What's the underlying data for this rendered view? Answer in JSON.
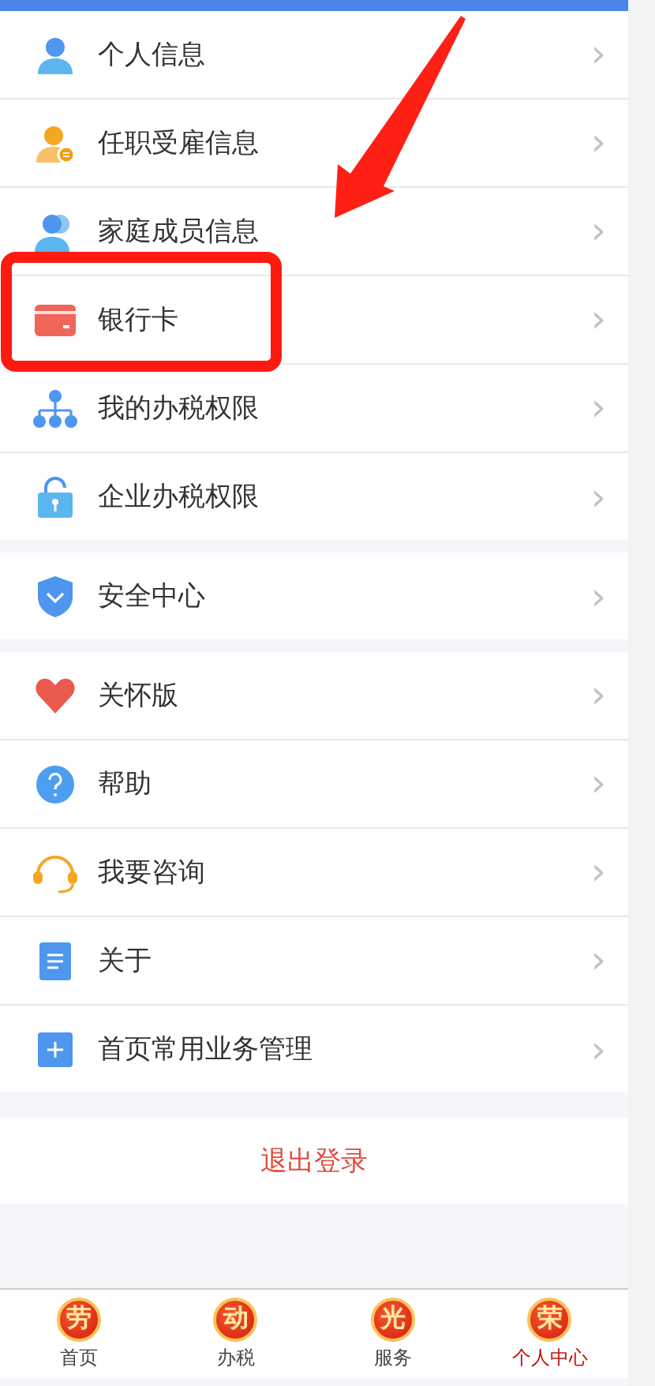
{
  "groups": [
    {
      "items": [
        {
          "label": "个人信息"
        },
        {
          "label": "任职受雇信息"
        },
        {
          "label": "家庭成员信息"
        },
        {
          "label": "银行卡"
        },
        {
          "label": "我的办税权限"
        },
        {
          "label": "企业办税权限"
        }
      ]
    },
    {
      "items": [
        {
          "label": "安全中心"
        }
      ]
    },
    {
      "items": [
        {
          "label": "关怀版"
        },
        {
          "label": "帮助"
        },
        {
          "label": "我要咨询"
        },
        {
          "label": "关于"
        },
        {
          "label": "首页常用业务管理"
        }
      ]
    }
  ],
  "chevron": "›",
  "logout": "退出登录",
  "tabs": [
    {
      "badge": "劳",
      "label": "首页",
      "selected": false
    },
    {
      "badge": "动",
      "label": "办税",
      "selected": false
    },
    {
      "badge": "光",
      "label": "服务",
      "selected": false
    },
    {
      "badge": "荣",
      "label": "个人中心",
      "selected": true
    }
  ]
}
